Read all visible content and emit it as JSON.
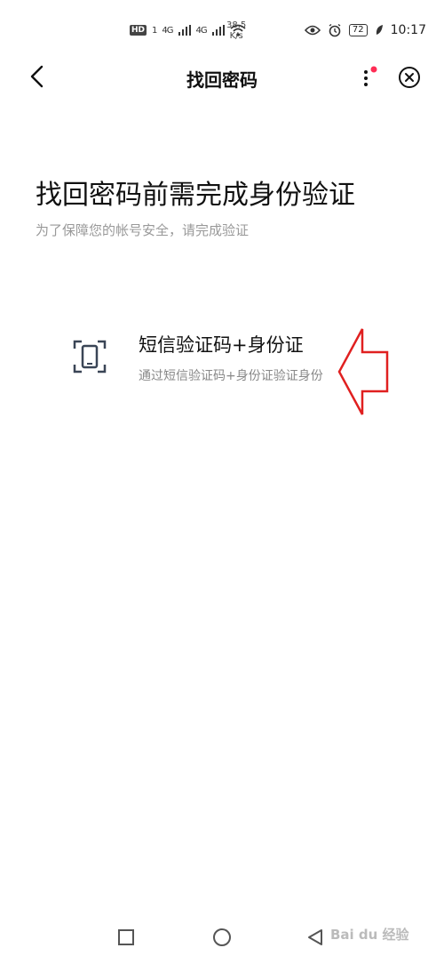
{
  "status_bar": {
    "hd": "HD",
    "sim": "1",
    "net1": "4G",
    "net2": "4G",
    "speed_value": "38.5",
    "speed_unit": "K/s",
    "battery": "72",
    "time": "10:17"
  },
  "nav": {
    "title": "找回密码"
  },
  "main": {
    "heading": "找回密码前需完成身份验证",
    "subheading": "为了保障您的帐号安全，请完成验证",
    "option": {
      "title": "短信验证码+身份证",
      "description": "通过短信验证码+身份证验证身份"
    }
  },
  "watermark": "Bai du 经验",
  "colors": {
    "annotation_arrow": "#e02020",
    "notification_dot": "#ff2d55",
    "icon": "#3a4556"
  }
}
